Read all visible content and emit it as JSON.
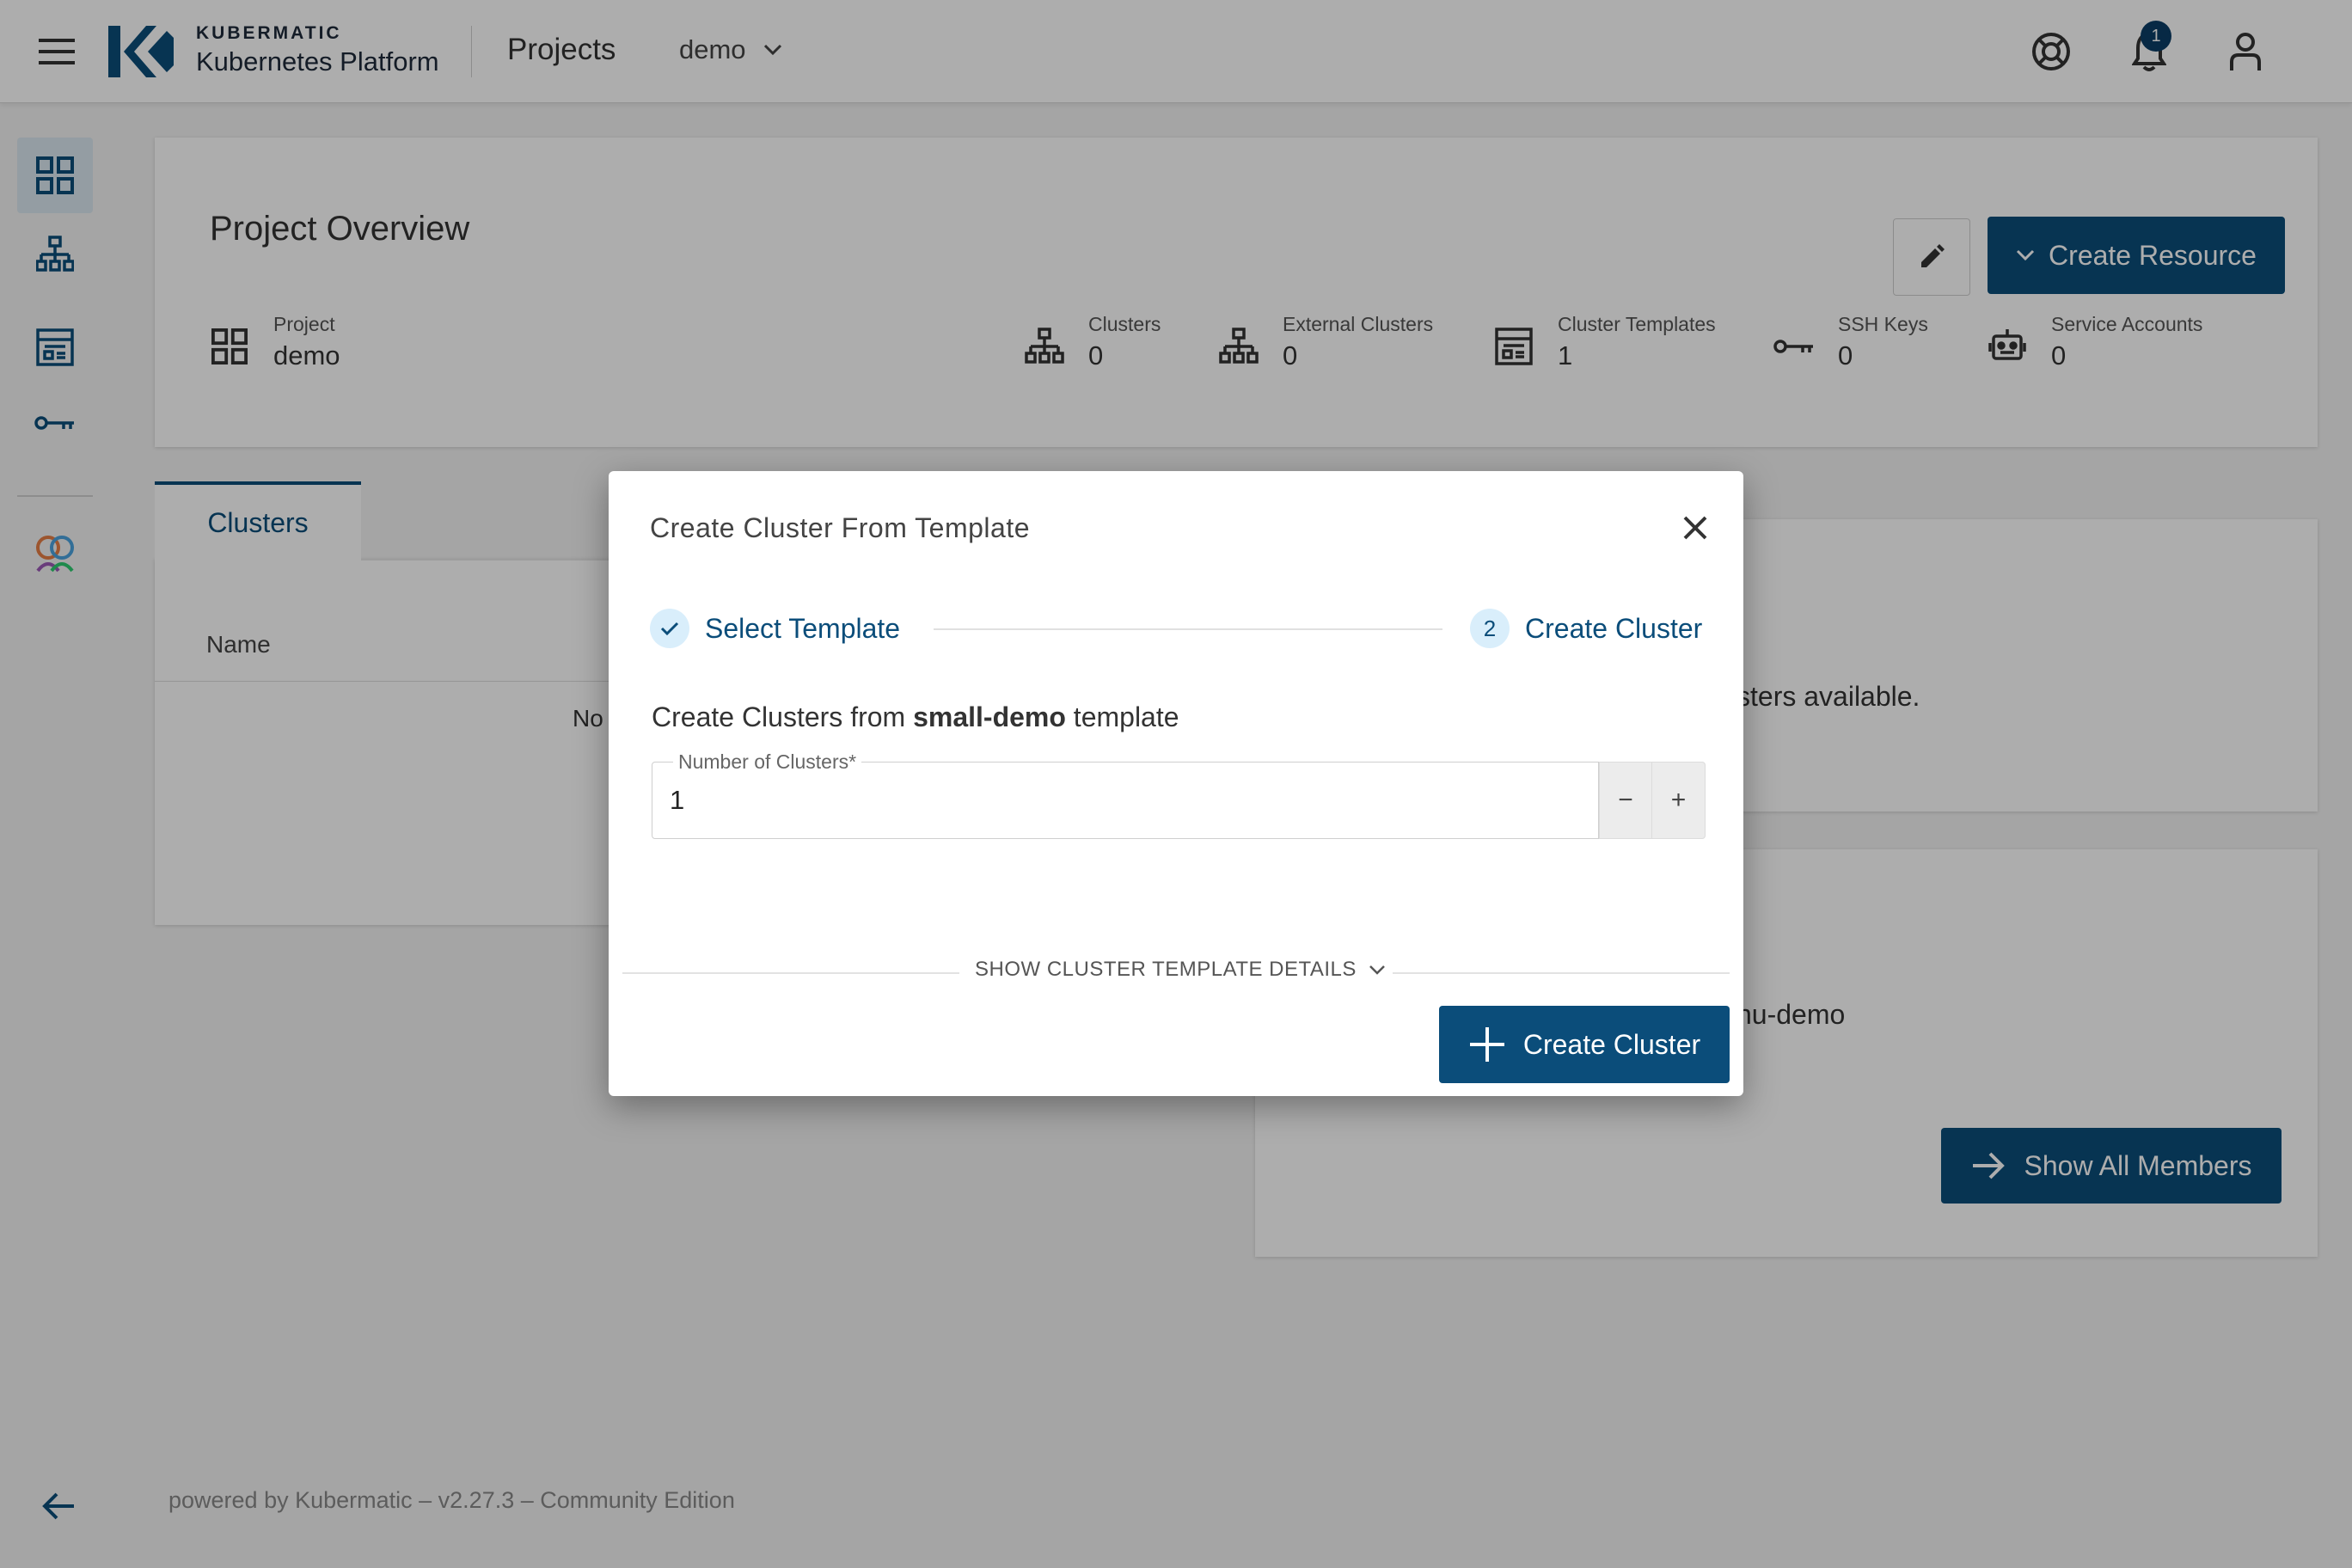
{
  "topbar": {
    "brand_top": "KUBERMATIC",
    "brand_bottom": "Kubernetes Platform",
    "projects_label": "Projects",
    "project_selected": "demo",
    "notification_count": "1"
  },
  "overview": {
    "title": "Project Overview",
    "create_resource_label": "Create Resource",
    "stats": [
      {
        "label": "Project",
        "value": "demo"
      },
      {
        "label": "Clusters",
        "value": "0"
      },
      {
        "label": "External Clusters",
        "value": "0"
      },
      {
        "label": "Cluster Templates",
        "value": "1"
      },
      {
        "label": "SSH Keys",
        "value": "0"
      },
      {
        "label": "Service Accounts",
        "value": "0"
      }
    ]
  },
  "clusters_card": {
    "tab_label": "Clusters",
    "column_name": "Name",
    "empty_text_fragment": "No"
  },
  "side_cards": {
    "available_fragment": "sters available.",
    "member_fragment": "nu-demo",
    "show_all_members_label": "Show All Members"
  },
  "footer": {
    "text": "powered by Kubermatic –  v2.27.3 –  Community Edition"
  },
  "dialog": {
    "title": "Create Cluster From Template",
    "step1_label": "Select Template",
    "step2_number": "2",
    "step2_label": "Create Cluster",
    "desc_prefix": "Create Clusters from ",
    "template_name": "small-demo",
    "desc_suffix": " template",
    "field_label": "Number of Clusters*",
    "field_value": "1",
    "decrement": "−",
    "increment": "+",
    "details_toggle": "SHOW CLUSTER TEMPLATE DETAILS",
    "create_button": "Create Cluster"
  },
  "colors": {
    "primary": "#0b4d7a",
    "step_bg": "#d9eefb"
  }
}
